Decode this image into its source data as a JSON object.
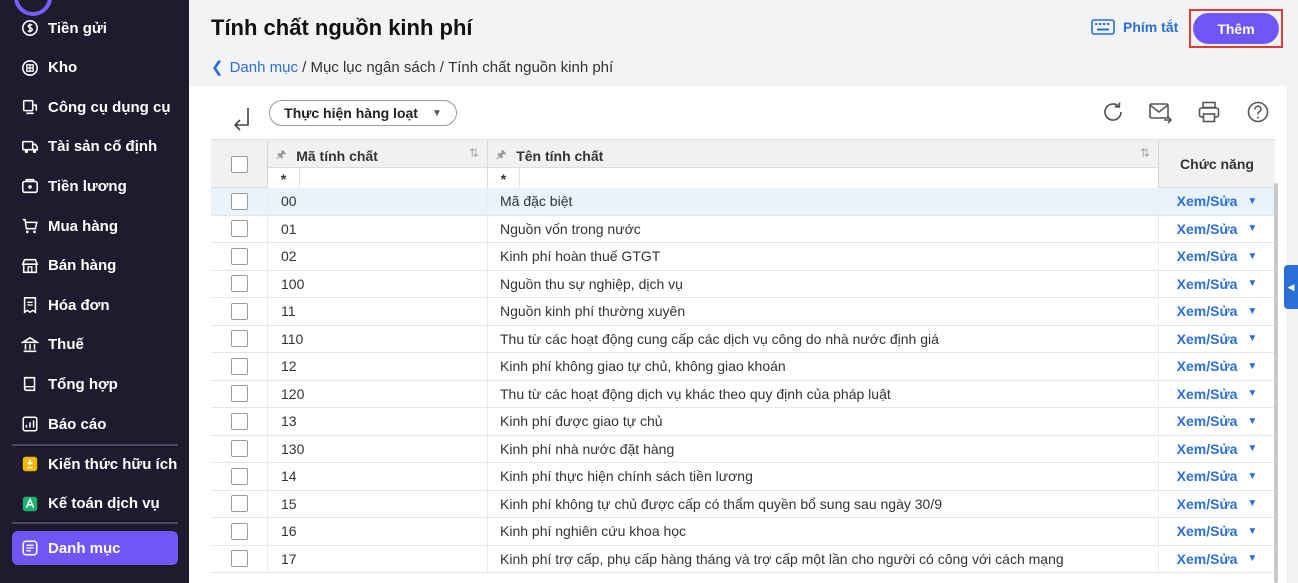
{
  "sidebar": {
    "items": [
      {
        "label": "Tiền gửi",
        "icon": "dollar-coin-icon"
      },
      {
        "label": "Kho",
        "icon": "warehouse-icon"
      },
      {
        "label": "Công cụ dụng cụ",
        "icon": "tools-icon"
      },
      {
        "label": "Tài sản cố định",
        "icon": "truck-icon"
      },
      {
        "label": "Tiền lương",
        "icon": "wallet-icon"
      },
      {
        "label": "Mua hàng",
        "icon": "cart-icon"
      },
      {
        "label": "Bán hàng",
        "icon": "store-icon"
      },
      {
        "label": "Hóa đơn",
        "icon": "invoice-icon"
      },
      {
        "label": "Thuế",
        "icon": "bank-icon"
      },
      {
        "label": "Tổng hợp",
        "icon": "book-icon"
      },
      {
        "label": "Báo cáo",
        "icon": "report-icon"
      }
    ],
    "extra_items": [
      {
        "label": "Kiến thức hữu ích",
        "icon": "knowledge-icon"
      },
      {
        "label": "Kế toán dịch vụ",
        "icon": "service-icon"
      }
    ],
    "active_item": {
      "label": "Danh mục",
      "icon": "catalog-icon"
    }
  },
  "header": {
    "title": "Tính chất nguồn kinh phí",
    "shortcut_label": "Phím tắt",
    "add_label": "Thêm",
    "breadcrumb": {
      "root": "Danh mục",
      "separator": " / ",
      "middle": "Mục lục ngân sách",
      "current": "Tính chất nguồn kinh phí"
    }
  },
  "toolbar": {
    "bulk_label": "Thực hiện hàng loạt"
  },
  "table": {
    "columns": {
      "code": "Mã tính chất",
      "name": "Tên tính chất",
      "func": "Chức năng",
      "filter_symbol": "*"
    },
    "action_label": "Xem/Sửa",
    "rows": [
      {
        "code": "00",
        "name": "Mã đặc biệt"
      },
      {
        "code": "01",
        "name": "Nguồn vốn trong nước"
      },
      {
        "code": "02",
        "name": "Kinh phí hoàn thuế GTGT"
      },
      {
        "code": "100",
        "name": "Nguồn thu sự nghiệp, dịch vụ"
      },
      {
        "code": "11",
        "name": "Nguồn kinh phí thường xuyên"
      },
      {
        "code": "110",
        "name": "Thu từ các hoạt động cung cấp các dịch vụ công do nhà nước định giá"
      },
      {
        "code": "12",
        "name": "Kinh phí không giao tự chủ, không giao khoán"
      },
      {
        "code": "120",
        "name": "Thu từ các hoạt động dịch vụ khác theo quy định của pháp luật"
      },
      {
        "code": "13",
        "name": "Kinh phí được giao tự chủ"
      },
      {
        "code": "130",
        "name": "Kinh phí nhà nước đặt hàng"
      },
      {
        "code": "14",
        "name": "Kinh phí thực hiện chính sách tiền lương"
      },
      {
        "code": "15",
        "name": "Kinh phí không tự chủ được cấp có thẩm quyền bổ sung sau ngày 30/9"
      },
      {
        "code": "16",
        "name": "Kinh phí nghiên cứu khoa học"
      },
      {
        "code": "17",
        "name": "Kinh phí trợ cấp, phụ cấp hàng tháng và trợ cấp một lần cho người có công với cách mạng"
      }
    ]
  }
}
